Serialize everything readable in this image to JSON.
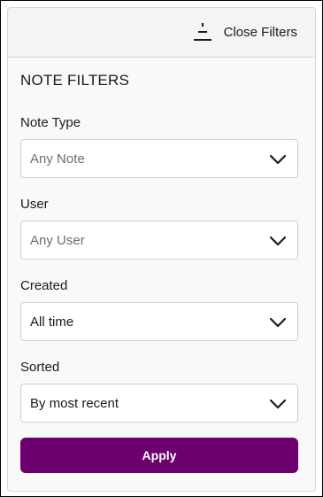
{
  "header": {
    "close_label": "Close Filters",
    "close_icon": "filter-collapse-icon"
  },
  "filters": {
    "title": "NOTE FILTERS",
    "note_type": {
      "label": "Note Type",
      "value": "Any Note",
      "is_placeholder": true
    },
    "user": {
      "label": "User",
      "value": "Any User",
      "is_placeholder": true
    },
    "created": {
      "label": "Created",
      "value": "All time",
      "is_placeholder": false
    },
    "sorted": {
      "label": "Sorted",
      "value": "By most recent",
      "is_placeholder": false
    }
  },
  "actions": {
    "apply_label": "Apply"
  },
  "colors": {
    "accent": "#6b006e",
    "placeholder_text": "#6d6d6d",
    "border": "#cfcfd2"
  }
}
